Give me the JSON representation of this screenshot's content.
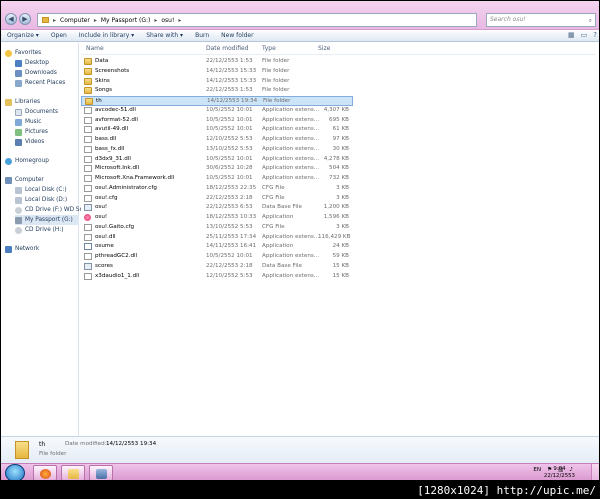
{
  "addressbar": {
    "crumbs": [
      "Computer",
      "My Passport (G:)",
      "osu!"
    ],
    "search_placeholder": "Search osu!"
  },
  "toolbar": {
    "organize": "Organize ▾",
    "open": "Open",
    "include": "Include in library ▾",
    "share": "Share with ▾",
    "burn": "Burn",
    "new_folder": "New folder"
  },
  "nav": {
    "favorites": "Favorites",
    "desktop": "Desktop",
    "downloads": "Downloads",
    "recent": "Recent Places",
    "libraries": "Libraries",
    "documents": "Documents",
    "music": "Music",
    "pictures": "Pictures",
    "videos": "Videos",
    "homegroup": "Homegroup",
    "computer": "Computer",
    "local_c": "Local Disk (C:)",
    "local_d": "Local Disk (D:)",
    "cd_f": "CD Drive (F:) WD Smi",
    "passport": "My Passport (G:)",
    "cd_h": "CD Drive (H:)",
    "network": "Network"
  },
  "columns": {
    "name": "Name",
    "date": "Date modified",
    "type": "Type",
    "size": "Size"
  },
  "files": [
    {
      "name": "Data",
      "date": "22/12/2553 1:53",
      "type": "File folder",
      "size": "",
      "icon": "folder"
    },
    {
      "name": "Screenshots",
      "date": "14/12/2553 15:33",
      "type": "File folder",
      "size": "",
      "icon": "folder"
    },
    {
      "name": "Skins",
      "date": "14/12/2553 15:33",
      "type": "File folder",
      "size": "",
      "icon": "folder"
    },
    {
      "name": "Songs",
      "date": "22/12/2553 1:53",
      "type": "File folder",
      "size": "",
      "icon": "folder"
    },
    {
      "name": "th",
      "date": "14/12/2553 19:34",
      "type": "File folder",
      "size": "",
      "icon": "folder"
    },
    {
      "name": "avcodec-51.dll",
      "date": "10/5/2552 10:01",
      "type": "Application extens...",
      "size": "4,307 KB",
      "icon": "file"
    },
    {
      "name": "avformat-52.dll",
      "date": "10/5/2552 10:01",
      "type": "Application extens...",
      "size": "695 KB",
      "icon": "file"
    },
    {
      "name": "avutil-49.dll",
      "date": "10/5/2552 10:01",
      "type": "Application extens...",
      "size": "61 KB",
      "icon": "file"
    },
    {
      "name": "bass.dll",
      "date": "12/10/2552 5:53",
      "type": "Application extens...",
      "size": "97 KB",
      "icon": "file"
    },
    {
      "name": "bass_fx.dll",
      "date": "13/10/2552 5:53",
      "type": "Application extens...",
      "size": "30 KB",
      "icon": "file"
    },
    {
      "name": "d3dx9_31.dll",
      "date": "10/5/2552 10:01",
      "type": "Application extens...",
      "size": "4,278 KB",
      "icon": "file"
    },
    {
      "name": "Microsoft.Ink.dll",
      "date": "30/6/2552 10:28",
      "type": "Application extens...",
      "size": "504 KB",
      "icon": "file"
    },
    {
      "name": "Microsoft.Xna.Framework.dll",
      "date": "10/5/2552 10:01",
      "type": "Application extens...",
      "size": "732 KB",
      "icon": "file"
    },
    {
      "name": "osu!.Administrator.cfg",
      "date": "18/12/2553 22:35",
      "type": "CFG File",
      "size": "3 KB",
      "icon": "file"
    },
    {
      "name": "osu!.cfg",
      "date": "22/12/2553 2:18",
      "type": "CFG File",
      "size": "3 KB",
      "icon": "file"
    },
    {
      "name": "osu!",
      "date": "22/12/2553 6:53",
      "type": "Data Base File",
      "size": "1,200 KB",
      "icon": "db"
    },
    {
      "name": "osu!",
      "date": "18/12/2553 10:33",
      "type": "Application",
      "size": "1,596 KB",
      "icon": "osu"
    },
    {
      "name": "osu!.Gaito.cfg",
      "date": "13/10/2552 5:53",
      "type": "CFG File",
      "size": "3 KB",
      "icon": "file"
    },
    {
      "name": "osu!.dll",
      "date": "25/11/2553 17:34",
      "type": "Application extens...",
      "size": "116,429 KB",
      "icon": "file"
    },
    {
      "name": "osume",
      "date": "14/11/2553 16:41",
      "type": "Application",
      "size": "24 KB",
      "icon": "app"
    },
    {
      "name": "pthreadGC2.dll",
      "date": "10/5/2552 10:01",
      "type": "Application extens...",
      "size": "59 KB",
      "icon": "file"
    },
    {
      "name": "scores",
      "date": "22/12/2553 2:18",
      "type": "Data Base File",
      "size": "15 KB",
      "icon": "db"
    },
    {
      "name": "x3daudio1_1.dll",
      "date": "12/10/2552 5:53",
      "type": "Application extens...",
      "size": "15 KB",
      "icon": "file"
    }
  ],
  "details": {
    "name": "th",
    "date_label": "Date modified:",
    "date": "14/12/2553 19:34",
    "type": "File folder"
  },
  "taskbar": {
    "lang": "EN",
    "time": "9:04",
    "date": "22/12/2553"
  },
  "watermark": "[1280x1024] http://upic.me/"
}
